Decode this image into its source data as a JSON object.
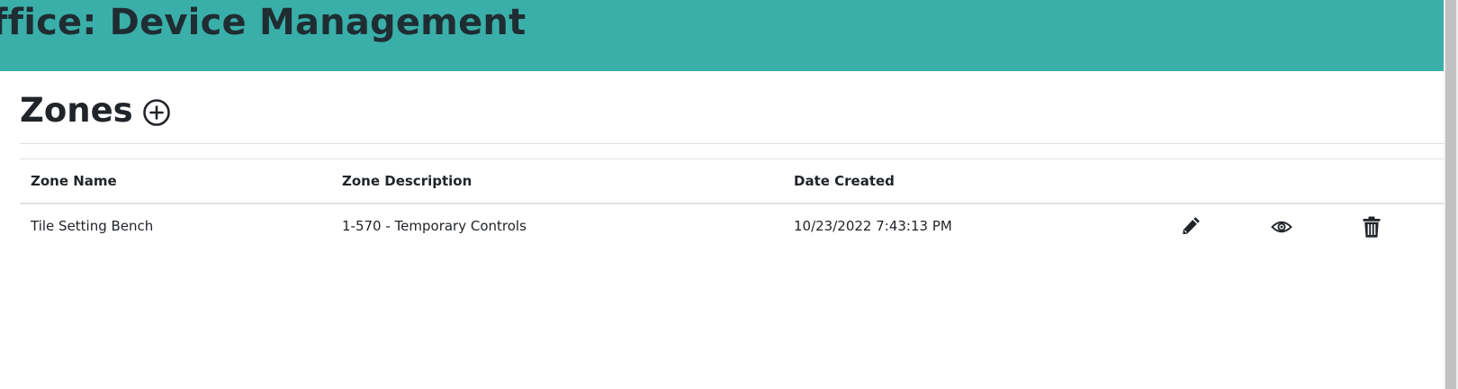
{
  "header": {
    "title": "ffice: Device Management"
  },
  "zones": {
    "title": "Zones",
    "add_icon": "plus-circle-icon"
  },
  "table": {
    "columns": [
      "Zone Name",
      "Zone Description",
      "Date Created"
    ],
    "rows": [
      {
        "zone_name": "Tile Setting Bench",
        "zone_description": "1-570 - Temporary Controls",
        "date_created": "10/23/2022 7:43:13 PM",
        "actions": [
          "pencil-icon",
          "eye-icon",
          "trash-icon"
        ]
      }
    ]
  },
  "colors": {
    "header_background": "#3aafa9",
    "header_text": "#1f2d33",
    "text": "#212529",
    "divider": "#dee2e6"
  }
}
